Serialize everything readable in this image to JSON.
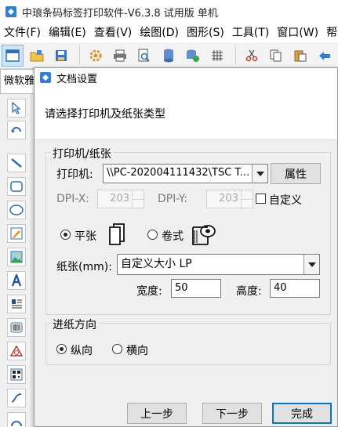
{
  "app": {
    "title": "中琅条码标签打印软件-V6.3.8 试用版 单机",
    "menu": [
      "文件(F)",
      "编辑(E)",
      "查看(V)",
      "绘图(D)",
      "图形(S)",
      "工具(T)",
      "窗口(W)",
      "帮"
    ],
    "font_combo": "微软雅"
  },
  "dialog": {
    "title": "文档设置",
    "prompt": "请选择打印机及纸张类型",
    "printer_group": {
      "label": "打印机/纸张",
      "printer_label": "打印机:",
      "printer_value": "\\\\PC-202004111432\\TSC T...",
      "properties_button": "属性",
      "dpix_label": "DPI-X:",
      "dpix_value": "203",
      "dpiy_label": "DPI-Y:",
      "dpiy_value": "203",
      "custom_label": "自定义",
      "sheet_label": "平张",
      "roll_label": "卷式",
      "paper_label": "纸张(mm):",
      "paper_value": "自定义大小 LP",
      "width_label": "宽度:",
      "width_value": "50",
      "height_label": "高度:",
      "height_value": "40"
    },
    "feed_group": {
      "label": "进纸方向",
      "portrait_label": "纵向",
      "landscape_label": "横向"
    },
    "buttons": {
      "prev": "上一步",
      "next": "下一步",
      "finish": "完成"
    }
  }
}
